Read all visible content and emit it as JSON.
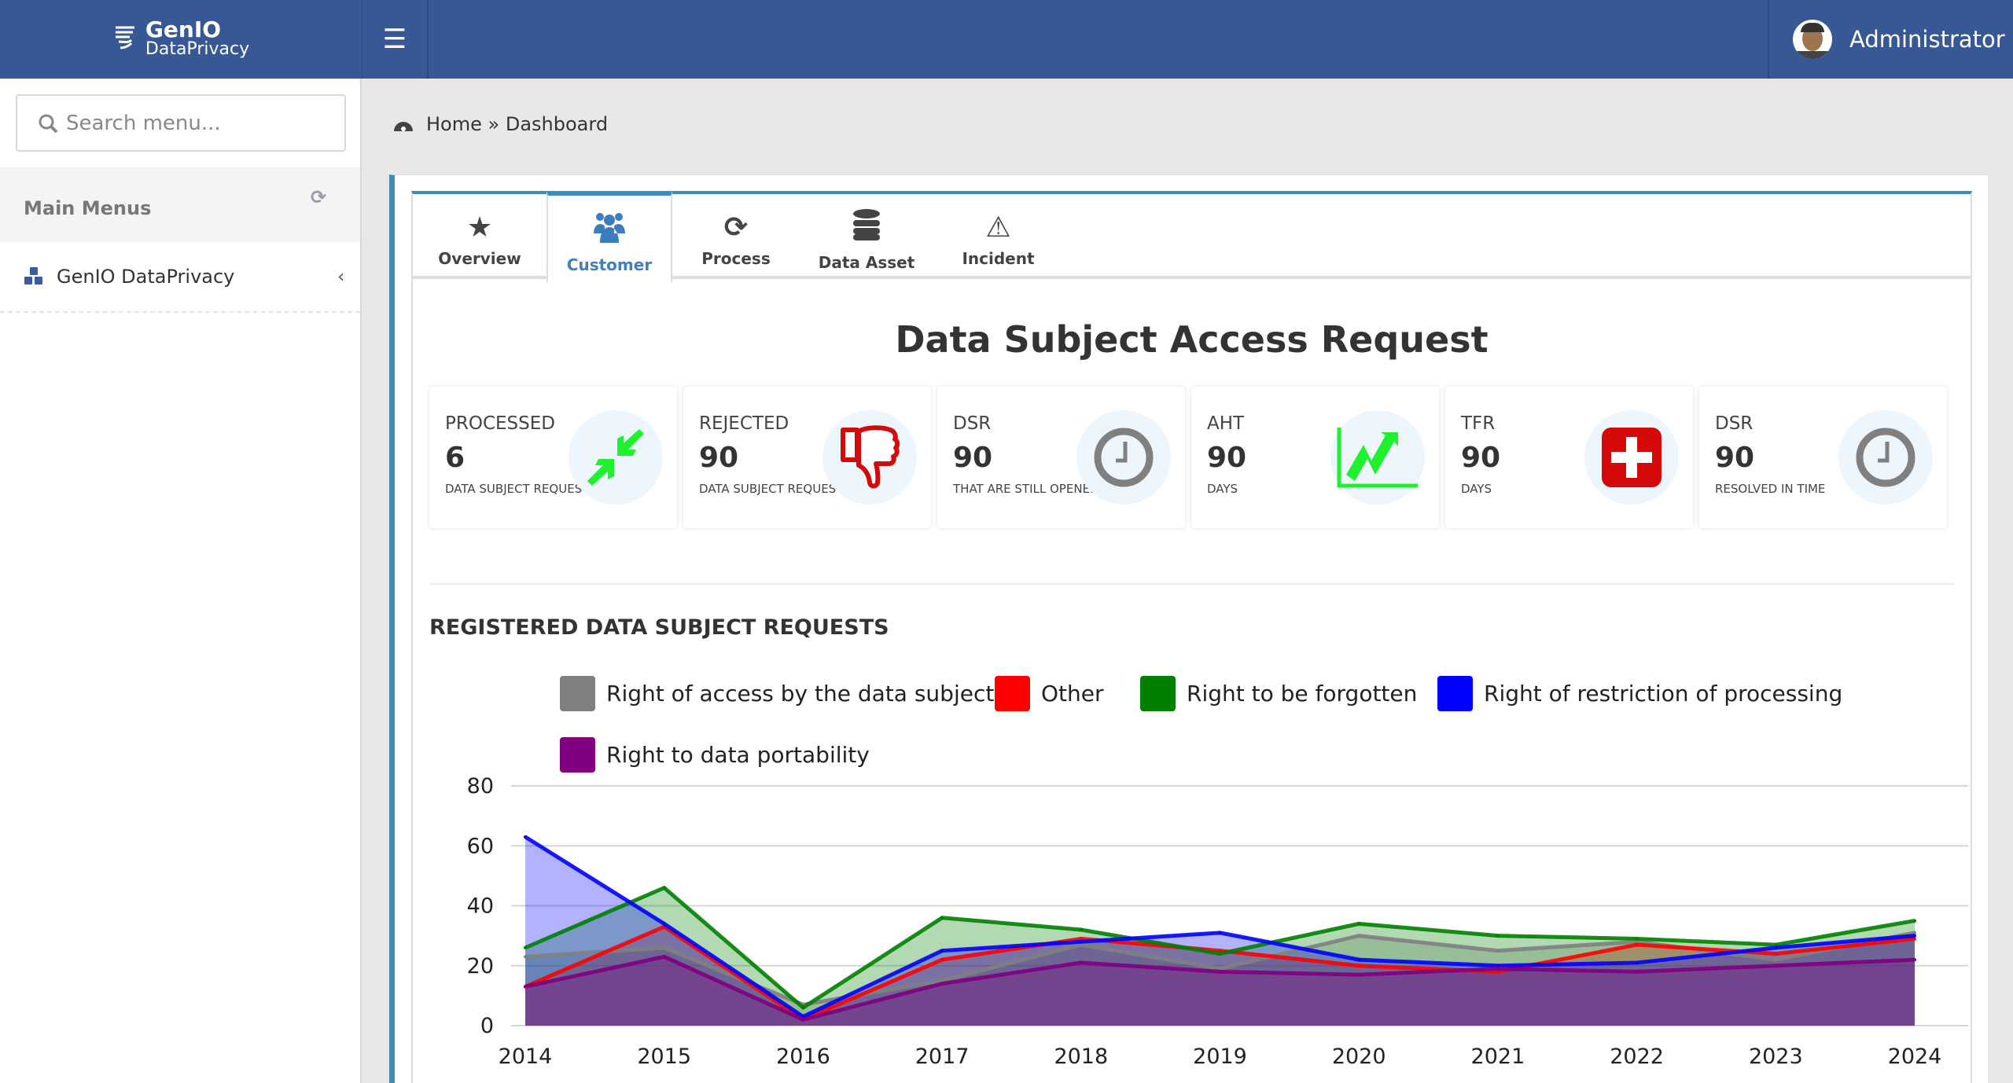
{
  "header": {
    "logo_line1": "GenIO",
    "logo_line2": "DataPrivacy",
    "user": "Administrator"
  },
  "sidebar": {
    "search_placeholder": "Search menu...",
    "section": "Main Menus",
    "items": [
      {
        "label": "GenIO DataPrivacy"
      }
    ]
  },
  "breadcrumb": {
    "home": "Home",
    "sep": "»",
    "current": "Dashboard"
  },
  "tabs": [
    {
      "label": "Overview",
      "icon": "star-icon"
    },
    {
      "label": "Customer",
      "icon": "users-icon",
      "active": true
    },
    {
      "label": "Process",
      "icon": "refresh-icon"
    },
    {
      "label": "Data Asset",
      "icon": "database-icon"
    },
    {
      "label": "Incident",
      "icon": "warning-icon"
    }
  ],
  "page_title": "Data Subject Access Request",
  "cards": [
    {
      "label": "PROCESSED",
      "value": "6",
      "sub": "DATA SUBJECT REQUESTS",
      "icon": "compress-arrows-icon",
      "color": "#1ef22e"
    },
    {
      "label": "REJECTED",
      "value": "90",
      "sub": "DATA SUBJECT REQUESTS",
      "icon": "thumbs-down-icon",
      "color": "#d40a0a"
    },
    {
      "label": "DSR",
      "value": "90",
      "sub": "THAT ARE STILL OPENED",
      "icon": "clock-icon",
      "color": "#808080"
    },
    {
      "label": "AHT",
      "value": "90",
      "sub": "DAYS",
      "icon": "line-chart-icon",
      "color": "#1ef22e"
    },
    {
      "label": "TFR",
      "value": "90",
      "sub": "DAYS",
      "icon": "plus-square-icon",
      "color": "#d40a0a"
    },
    {
      "label": "DSR",
      "value": "90",
      "sub": "RESOLVED IN TIME",
      "icon": "clock-icon",
      "color": "#808080"
    }
  ],
  "section_title": "REGISTERED DATA SUBJECT REQUESTS",
  "chart_data": {
    "type": "area",
    "x": [
      "2014",
      "2015",
      "2016",
      "2017",
      "2018",
      "2019",
      "2020",
      "2021",
      "2022",
      "2023",
      "2024"
    ],
    "ylim": [
      0,
      80
    ],
    "yticks": [
      "0",
      "20",
      "40",
      "60",
      "80"
    ],
    "grid": true,
    "legend": "top",
    "series": [
      {
        "name": "Right of access by the data subject",
        "color": "#808080",
        "values": [
          23,
          26,
          7,
          15,
          27,
          19,
          30,
          25,
          28,
          22,
          31
        ]
      },
      {
        "name": "Other",
        "color": "#ff0000",
        "values": [
          13,
          33,
          2,
          22,
          29,
          25,
          20,
          18,
          27,
          24,
          29
        ]
      },
      {
        "name": "Right to be forgotten",
        "color": "#008000",
        "values": [
          26,
          46,
          6,
          36,
          32,
          24,
          34,
          30,
          29,
          27,
          35
        ]
      },
      {
        "name": "Right of restriction of processing",
        "color": "#0000ff",
        "values": [
          63,
          34,
          3,
          25,
          28,
          31,
          22,
          20,
          21,
          26,
          30
        ]
      },
      {
        "name": "Right to data portability",
        "color": "#800080",
        "values": [
          13,
          23,
          2,
          14,
          21,
          18,
          17,
          19,
          18,
          20,
          22
        ]
      }
    ]
  }
}
